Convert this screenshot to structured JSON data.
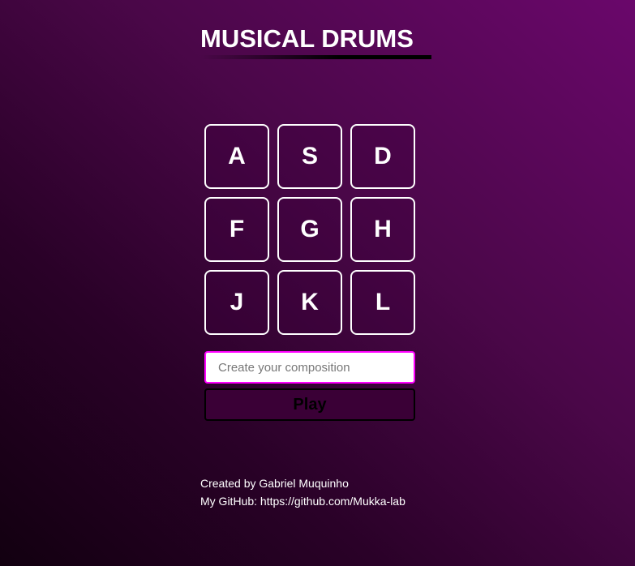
{
  "header": {
    "title": "MUSICAL DRUMS"
  },
  "keys": [
    "A",
    "S",
    "D",
    "F",
    "G",
    "H",
    "J",
    "K",
    "L"
  ],
  "composition": {
    "placeholder": "Create your composition",
    "value": ""
  },
  "play_label": "Play",
  "footer": {
    "created_by": "Created by Gabriel Muquinho",
    "github": "My GitHub: https://github.com/Mukka-lab"
  },
  "colors": {
    "input_border": "#ff00ff",
    "bg_top_right": "#6a076b",
    "bg_bottom_left": "#120010"
  }
}
